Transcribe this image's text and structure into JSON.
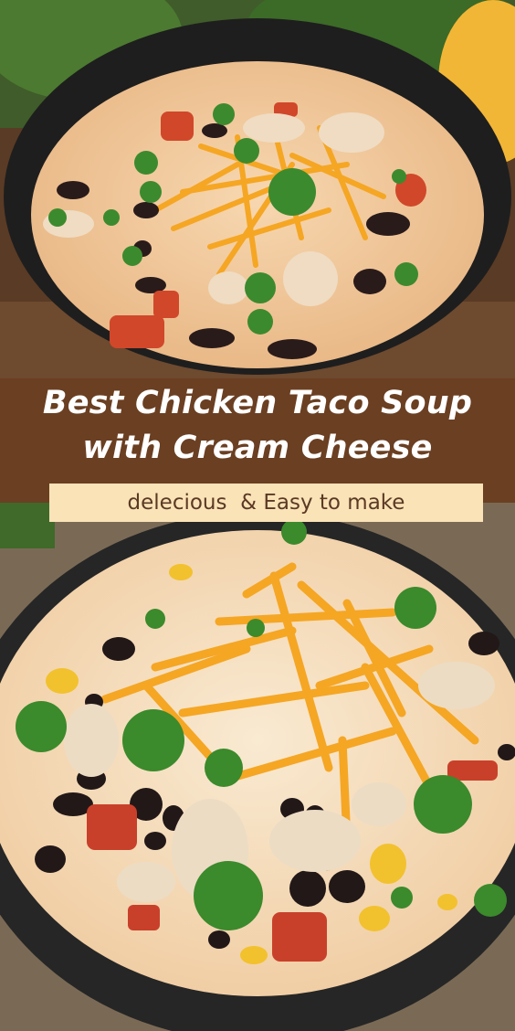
{
  "title": {
    "line1": "Best Chicken Taco Soup",
    "line2": "with Cream Cheese"
  },
  "subtitle": "delecious  & Easy to make",
  "colors": {
    "title_band": "#6b3f22",
    "title_text": "#ffffff",
    "subtitle_box": "#fbe3b8",
    "subtitle_text": "#5a3a24",
    "soup": "#f0c9a0",
    "cheese": "#f5a623",
    "bowl": "#1e1e1e"
  },
  "photos": {
    "top": "chicken-taco-soup-bowl-photo",
    "bottom": "chicken-taco-soup-closeup-photo"
  }
}
